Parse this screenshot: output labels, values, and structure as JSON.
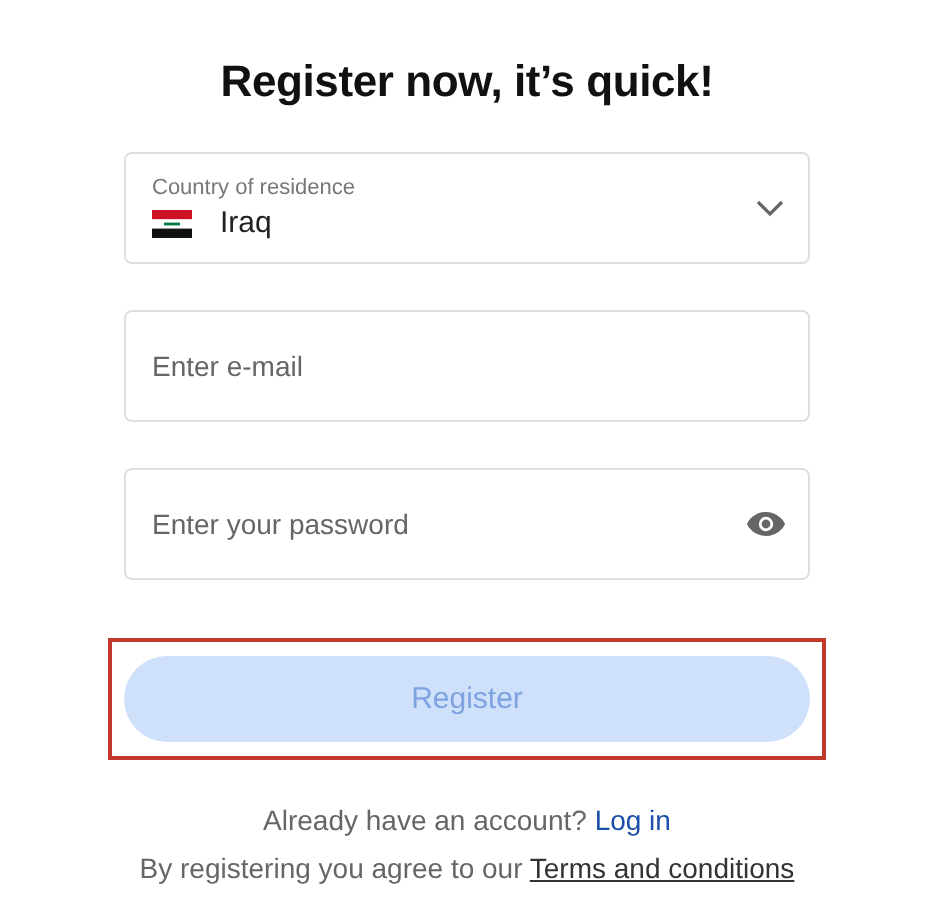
{
  "title": "Register now, it’s quick!",
  "country": {
    "label": "Country of residence",
    "value": "Iraq"
  },
  "email": {
    "placeholder": "Enter e-mail"
  },
  "password": {
    "placeholder": "Enter your password"
  },
  "register_button": {
    "label": "Register",
    "disabled": true,
    "highlighted": true
  },
  "login_prompt": {
    "text": "Already have an account?",
    "link": "Log in"
  },
  "terms": {
    "text": "By registering you agree to our",
    "link": "Terms and conditions"
  }
}
